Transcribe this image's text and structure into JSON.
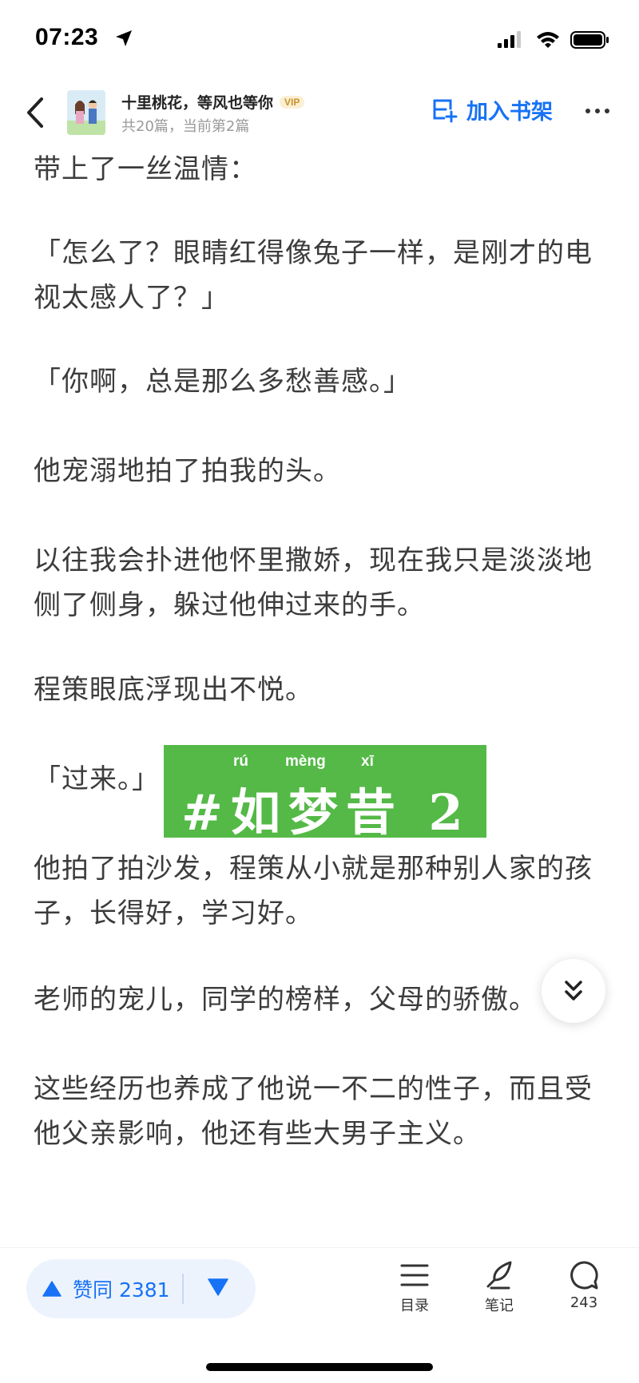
{
  "status_bar": {
    "time": "07:23",
    "icons": [
      "location-arrow-icon",
      "cellular-signal-icon",
      "wifi-icon",
      "battery-icon"
    ]
  },
  "nav": {
    "book_title": "十里桃花，等风也等你",
    "vip_label": "VIP",
    "subtitle": "共20篇，当前第2篇",
    "add_shelf_label": "加入书架",
    "accent_color": "#1772f6"
  },
  "content": {
    "paragraphs": [
      {
        "lines": [
          "带上了一丝温情："
        ]
      },
      {
        "lines": [
          "「怎么了？眼睛红得像兔子一样，是刚才的电",
          "视太感人了？」"
        ]
      },
      {
        "lines": [
          "「你啊，总是那么多愁善感。」"
        ]
      },
      {
        "lines": [
          "他宠溺地拍了拍我的头。"
        ]
      },
      {
        "lines": [
          "以往我会扑进他怀里撒娇，现在我只是淡淡地",
          "侧了侧身，躲过他伸过来的手。"
        ]
      },
      {
        "lines": [
          "程策眼底浮现出不悦。"
        ]
      },
      {
        "lines": [
          "「过来。」"
        ]
      },
      {
        "lines": [
          "他拍了拍沙发，程策从小就是那种别人家的孩",
          "子，长得好，学习好。"
        ]
      },
      {
        "lines": [
          "老师的宠儿，同学的榜样，父母的骄傲。"
        ]
      },
      {
        "lines": [
          "这些经历也养成了他说一不二的性子，而且受",
          "他父亲影响，他还有些大男子主义。"
        ]
      }
    ]
  },
  "banner": {
    "text": "#如梦昔 2",
    "pinyin": [
      "rú",
      "mèng",
      "xī"
    ],
    "color": "#54b946"
  },
  "bottom_bar": {
    "upvote_label": "赞同 2381",
    "toc_label": "目录",
    "notes_label": "笔记",
    "comments_count": "243"
  }
}
